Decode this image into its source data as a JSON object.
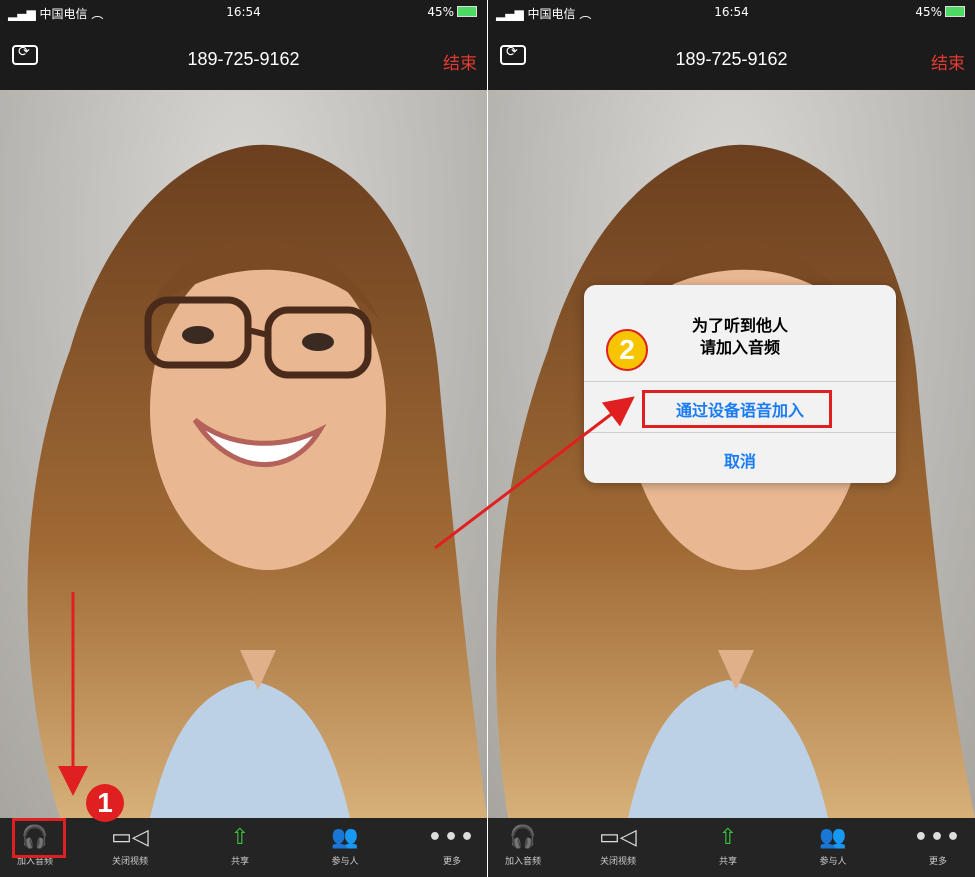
{
  "status": {
    "carrier": "中国电信",
    "time": "16:54",
    "battery": "45%"
  },
  "header": {
    "meeting_id": "189-725-9162",
    "end_label": "结束"
  },
  "toolbar": [
    {
      "label": "加入音频",
      "icon": "headphone-icon"
    },
    {
      "label": "关闭视频",
      "icon": "video-camera-icon"
    },
    {
      "label": "共享",
      "icon": "share-icon"
    },
    {
      "label": "参与人",
      "icon": "participants-icon"
    },
    {
      "label": "更多",
      "icon": "more-icon"
    }
  ],
  "dialog": {
    "title_line1": "为了听到他人",
    "title_line2": "请加入音频",
    "join_device_audio": "通过设备语音加入",
    "cancel": "取消"
  },
  "annotations": {
    "step1": "1",
    "step2": "2"
  },
  "colors": {
    "end": "#e53b30",
    "highlight": "#e02020",
    "link": "#1a7cf2",
    "share": "#3cc83c",
    "badge2": "#f7c400"
  }
}
